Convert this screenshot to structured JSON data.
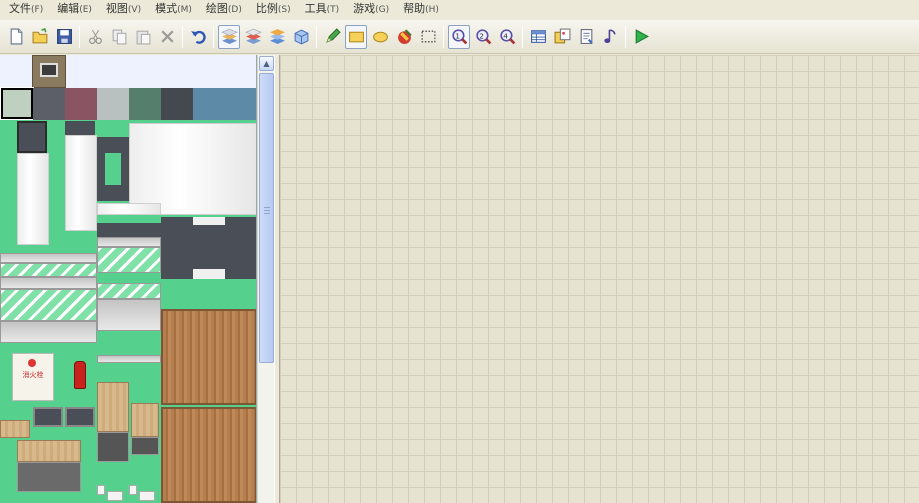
{
  "menu": [
    {
      "label": "文件",
      "accel": "(F)"
    },
    {
      "label": "编辑",
      "accel": "(E)"
    },
    {
      "label": "视图",
      "accel": "(V)"
    },
    {
      "label": "模式",
      "accel": "(M)"
    },
    {
      "label": "绘图",
      "accel": "(D)"
    },
    {
      "label": "比例",
      "accel": "(S)"
    },
    {
      "label": "工具",
      "accel": "(T)"
    },
    {
      "label": "游戏",
      "accel": "(G)"
    },
    {
      "label": "帮助",
      "accel": "(H)"
    }
  ],
  "toolbar": {
    "new_icon": "new-file-icon",
    "open_icon": "open-folder-icon",
    "save_icon": "save-icon",
    "cut_icon": "cut-icon",
    "copy_icon": "copy-icon",
    "paste_icon": "paste-icon",
    "delete_icon": "delete-icon",
    "undo_icon": "undo-icon",
    "layer_icons": [
      "layer-1-icon",
      "layer-2-icon",
      "layer-3-icon",
      "event-layer-icon"
    ],
    "draw_icons": [
      "pencil-icon",
      "rectangle-icon",
      "ellipse-icon",
      "fill-icon",
      "select-icon"
    ],
    "zoom_icons": [
      "zoom-1-1-icon",
      "zoom-1-2-icon",
      "zoom-1-4-icon"
    ],
    "tool_icons": [
      "database-icon",
      "material-icon",
      "script-icon",
      "sound-icon"
    ],
    "play_icon": "play-icon"
  },
  "tile_panel": {
    "fire_hydrant_label": "消火栓"
  },
  "colors": {
    "grass": "#55d18d",
    "grid_bg": "#e6e3d1",
    "grid_line": "#d3cfb8",
    "accent_play": "#2fb34a"
  }
}
